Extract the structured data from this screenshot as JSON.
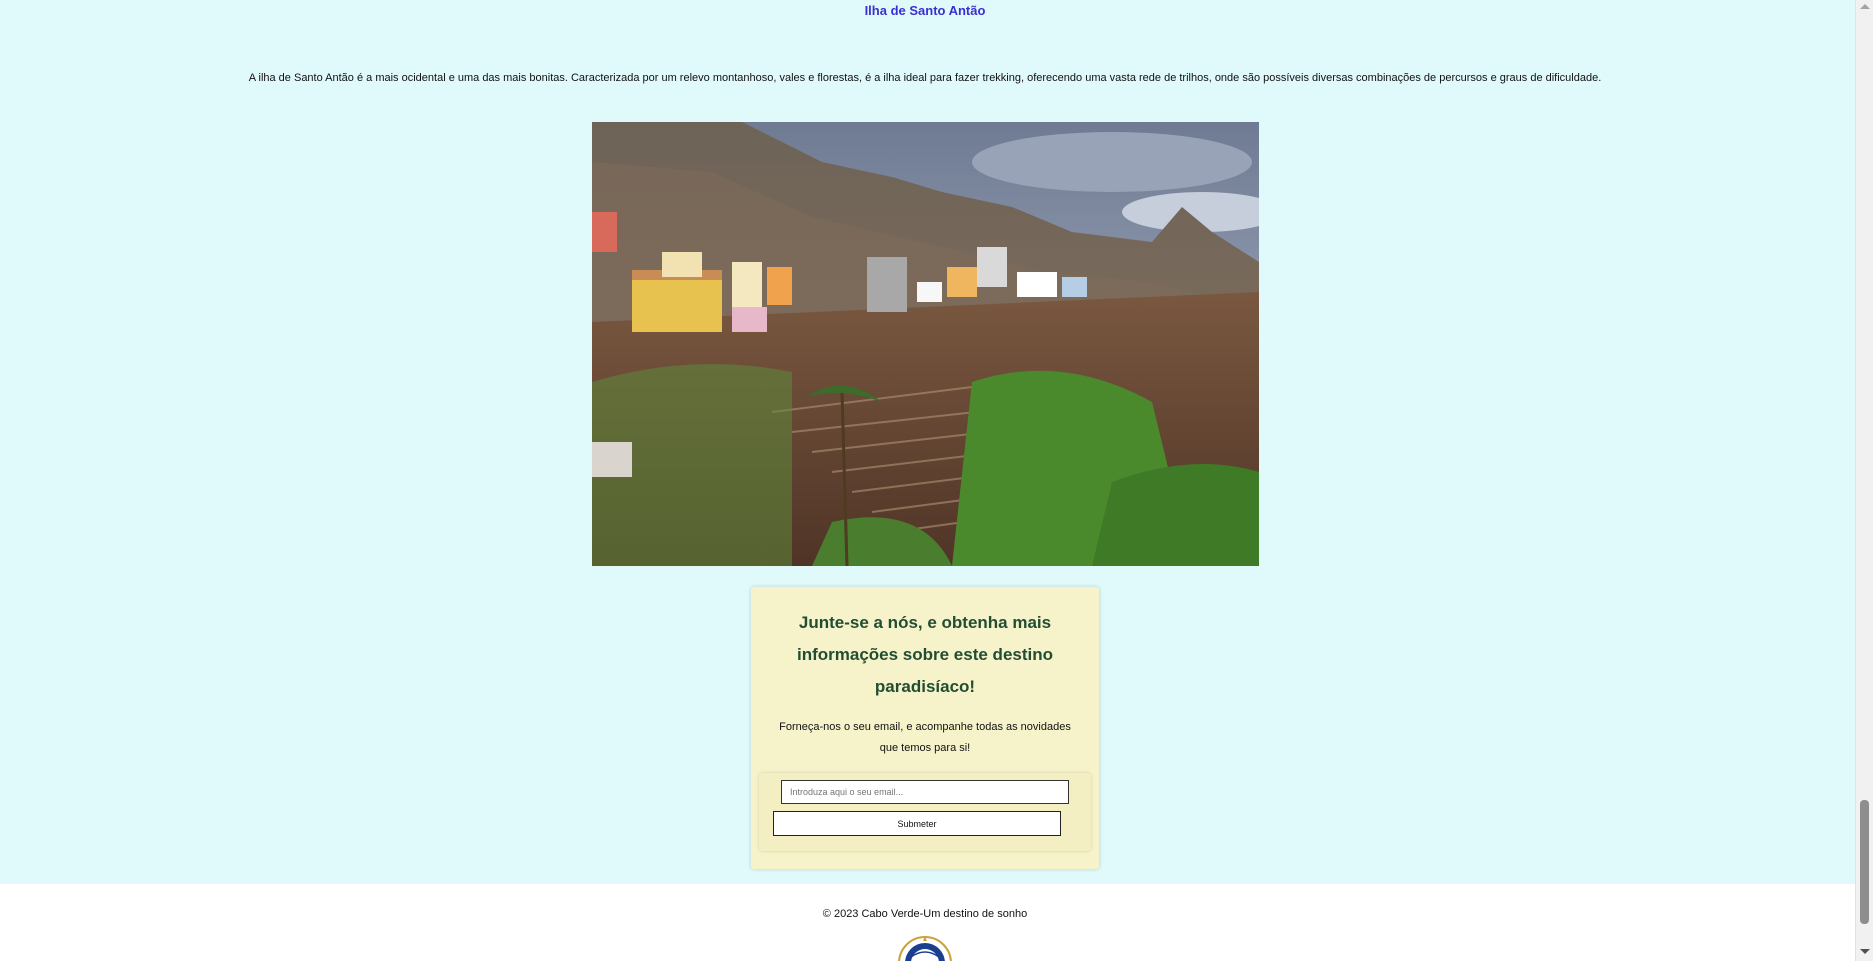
{
  "island": {
    "title": "Ilha de Santo Antão",
    "description": "A ilha de Santo Antão é a mais ocidental e uma das mais bonitas. Caracterizada por um relevo montanhoso, vales e florestas, é a ilha ideal para fazer trekking, oferecendo uma vasta rede de trilhos, onde são possíveis diversas combinações de percursos e graus de dificuldade.",
    "image_subject": "terraced-mountain-village-photo"
  },
  "signup": {
    "heading": "Junte-se a nós, e obtenha mais informações sobre este destino paradisíaco!",
    "text": "Forneça-nos o seu email, e acompanhe todas as novidades que temos para si!",
    "email_placeholder": "Introduza aqui o seu email...",
    "email_value": "",
    "submit_label": "Submeter"
  },
  "footer": {
    "copyright": "© 2023 Cabo Verde-Um destino de sonho",
    "logo": "cabo-verde-emblem-icon"
  },
  "colors": {
    "page_background": "#e0fafb",
    "title_link": "#3b2fd1",
    "card_background": "#f6f3ca",
    "card_heading": "#234d33"
  }
}
